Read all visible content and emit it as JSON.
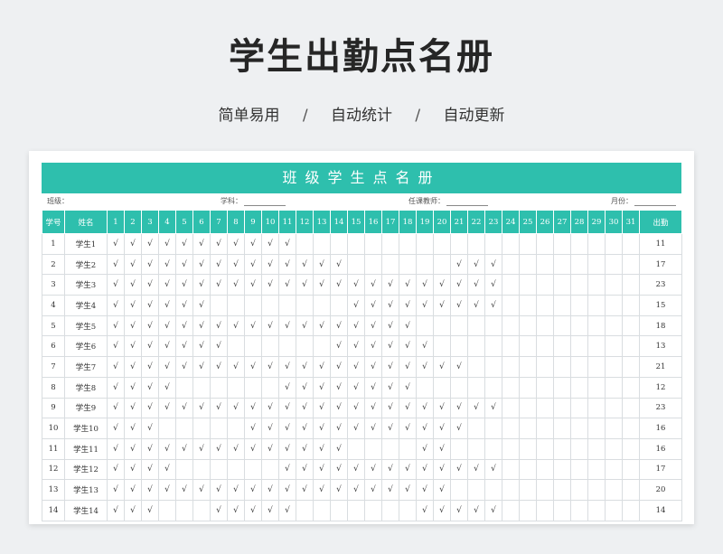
{
  "header": {
    "title": "学生出勤点名册",
    "tags": [
      "简单易用",
      "自动统计",
      "自动更新"
    ],
    "separator": "/"
  },
  "sheet": {
    "banner": "班级学生点名册",
    "meta": {
      "class_label": "班级：",
      "subject_label": "学科：",
      "teacher_label": "任课教师：",
      "month_label": "月份："
    },
    "columns": {
      "no": "学号",
      "name": "姓名",
      "days": [
        "1",
        "2",
        "3",
        "4",
        "5",
        "6",
        "7",
        "8",
        "9",
        "10",
        "11",
        "12",
        "13",
        "14",
        "15",
        "16",
        "17",
        "18",
        "19",
        "20",
        "21",
        "22",
        "23",
        "24",
        "25",
        "26",
        "27",
        "28",
        "29",
        "30",
        "31"
      ],
      "total": "出勤"
    },
    "check_symbol": "√",
    "rows": [
      {
        "no": "1",
        "name": "学生1",
        "days": [
          1,
          2,
          3,
          4,
          5,
          6,
          7,
          8,
          9,
          10,
          11
        ],
        "total": "11"
      },
      {
        "no": "2",
        "name": "学生2",
        "days": [
          1,
          2,
          3,
          4,
          5,
          6,
          7,
          8,
          9,
          10,
          11,
          12,
          13,
          14,
          21,
          22,
          23
        ],
        "total": "17"
      },
      {
        "no": "3",
        "name": "学生3",
        "days": [
          1,
          2,
          3,
          4,
          5,
          6,
          7,
          8,
          9,
          10,
          11,
          12,
          13,
          14,
          15,
          16,
          17,
          18,
          19,
          20,
          21,
          22,
          23
        ],
        "total": "23"
      },
      {
        "no": "4",
        "name": "学生4",
        "days": [
          1,
          2,
          3,
          4,
          5,
          6,
          15,
          16,
          17,
          18,
          19,
          20,
          21,
          22,
          23
        ],
        "total": "15"
      },
      {
        "no": "5",
        "name": "学生5",
        "days": [
          1,
          2,
          3,
          4,
          5,
          6,
          7,
          8,
          9,
          10,
          11,
          12,
          13,
          14,
          15,
          16,
          17,
          18
        ],
        "total": "18"
      },
      {
        "no": "6",
        "name": "学生6",
        "days": [
          1,
          2,
          3,
          4,
          5,
          6,
          7,
          14,
          15,
          16,
          17,
          18,
          19
        ],
        "total": "13"
      },
      {
        "no": "7",
        "name": "学生7",
        "days": [
          1,
          2,
          3,
          4,
          5,
          6,
          7,
          8,
          9,
          10,
          11,
          12,
          13,
          14,
          15,
          16,
          17,
          18,
          19,
          20,
          21
        ],
        "total": "21"
      },
      {
        "no": "8",
        "name": "学生8",
        "days": [
          1,
          2,
          3,
          4,
          11,
          12,
          13,
          14,
          15,
          16,
          17,
          18
        ],
        "total": "12"
      },
      {
        "no": "9",
        "name": "学生9",
        "days": [
          1,
          2,
          3,
          4,
          5,
          6,
          7,
          8,
          9,
          10,
          11,
          12,
          13,
          14,
          15,
          16,
          17,
          18,
          19,
          20,
          21,
          22,
          23
        ],
        "total": "23"
      },
      {
        "no": "10",
        "name": "学生10",
        "days": [
          1,
          2,
          3,
          9,
          10,
          11,
          12,
          13,
          14,
          15,
          16,
          17,
          18,
          19,
          20,
          21
        ],
        "total": "16"
      },
      {
        "no": "11",
        "name": "学生11",
        "days": [
          1,
          2,
          3,
          4,
          5,
          6,
          7,
          8,
          9,
          10,
          11,
          12,
          13,
          14,
          19,
          20
        ],
        "total": "16"
      },
      {
        "no": "12",
        "name": "学生12",
        "days": [
          1,
          2,
          3,
          4,
          11,
          12,
          13,
          14,
          15,
          16,
          17,
          18,
          19,
          20,
          21,
          22,
          23
        ],
        "total": "17"
      },
      {
        "no": "13",
        "name": "学生13",
        "days": [
          1,
          2,
          3,
          4,
          5,
          6,
          7,
          8,
          9,
          10,
          11,
          12,
          13,
          14,
          15,
          16,
          17,
          18,
          19,
          20
        ],
        "total": "20"
      },
      {
        "no": "14",
        "name": "学生14",
        "days": [
          1,
          2,
          3,
          7,
          8,
          9,
          10,
          11,
          19,
          20,
          21,
          22,
          23
        ],
        "total": "14"
      }
    ]
  },
  "colors": {
    "accent": "#2ebfad",
    "page_bg": "#eef0f2"
  }
}
